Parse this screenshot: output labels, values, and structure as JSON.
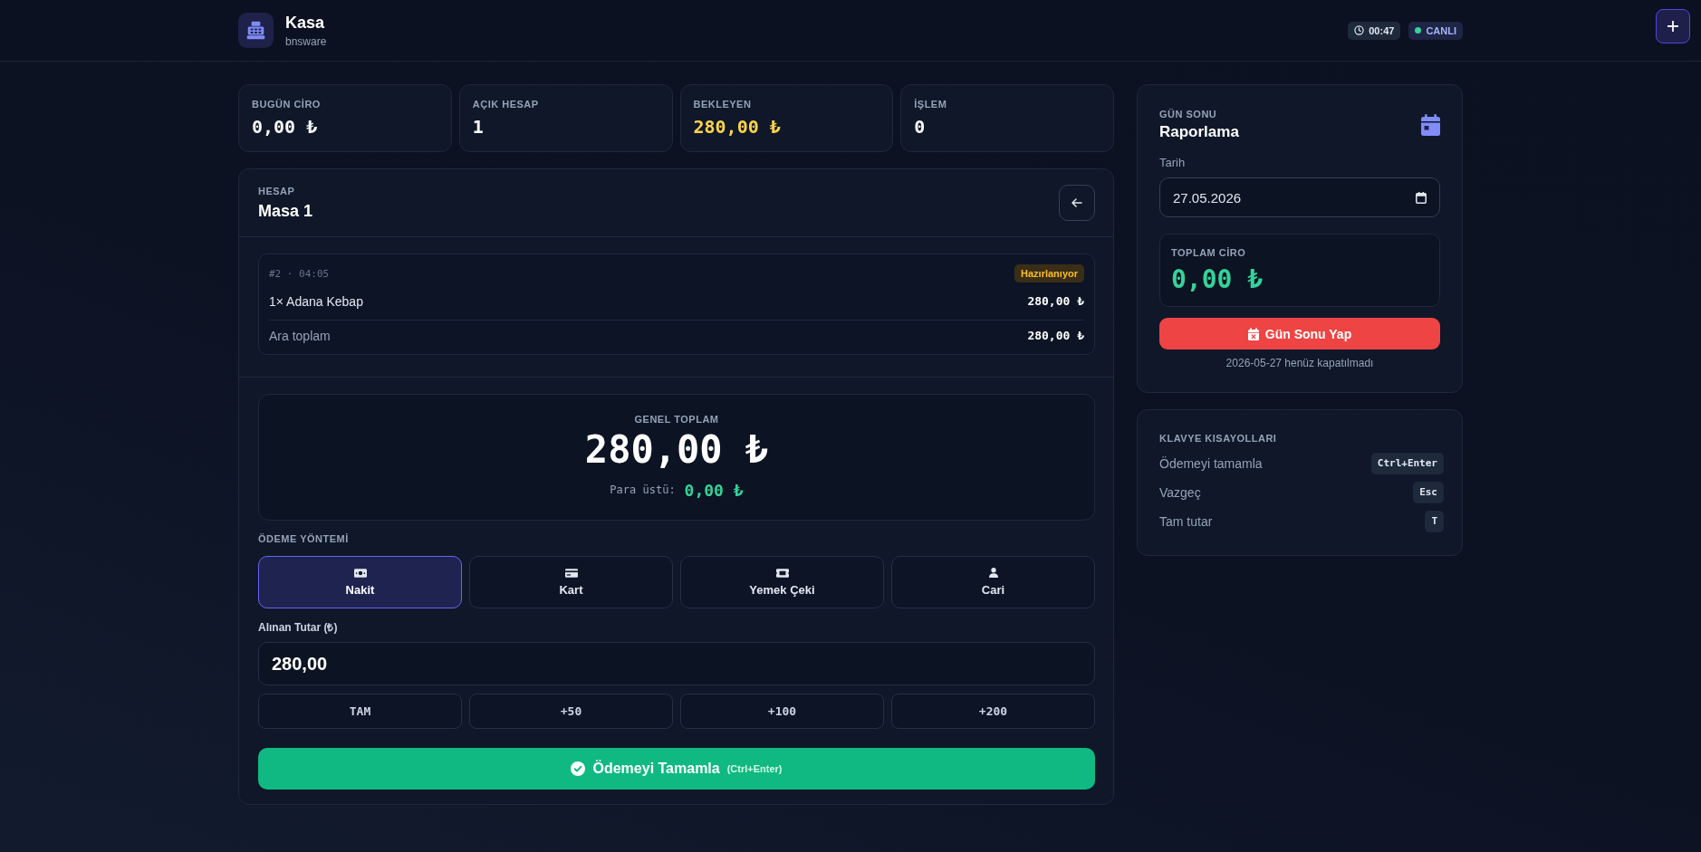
{
  "header": {
    "title": "Kasa",
    "subtitle": "bnsware",
    "timer": "00:47",
    "status": "CANLI"
  },
  "stats": [
    {
      "label": "BUGÜN CİRO",
      "value": "0,00 ₺",
      "color": "#f8fafc"
    },
    {
      "label": "AÇIK HESAP",
      "value": "1",
      "color": "#f8fafc"
    },
    {
      "label": "BEKLEYEN",
      "value": "280,00 ₺",
      "color": "#fcd34d"
    },
    {
      "label": "İŞLEM",
      "value": "0",
      "color": "#f8fafc"
    }
  ],
  "account": {
    "label": "HESAP",
    "title": "Masa 1",
    "order": {
      "meta": "#2 · 04:05",
      "status": "Hazırlanıyor",
      "items": [
        {
          "name": "1× Adana Kebap",
          "price": "280,00 ₺"
        }
      ],
      "subtotal_label": "Ara toplam",
      "subtotal": "280,00 ₺"
    },
    "total": {
      "label": "GENEL TOPLAM",
      "value": "280,00 ₺",
      "change_label": "Para üstü:",
      "change": "0,00 ₺"
    },
    "payment": {
      "label": "ÖDEME YÖNTEMİ",
      "methods": [
        {
          "label": "Nakit",
          "kind": "cash",
          "selected": true
        },
        {
          "label": "Kart",
          "kind": "card",
          "selected": false
        },
        {
          "label": "Yemek Çeki",
          "kind": "voucher",
          "selected": false
        },
        {
          "label": "Cari",
          "kind": "person",
          "selected": false
        }
      ]
    },
    "amount": {
      "label": "Alınan Tutar (₺)",
      "value": "280,00"
    },
    "quick_amounts": [
      "TAM",
      "+50",
      "+100",
      "+200"
    ],
    "submit": {
      "label": "Ödemeyi Tamamla",
      "shortcut": "(Ctrl+Enter)"
    }
  },
  "day_end": {
    "eyebrow": "GÜN SONU",
    "title": "Raporlama",
    "date_label": "Tarih",
    "date": "27.05.2026",
    "total_label": "TOPLAM CİRO",
    "total": "0,00 ₺",
    "button": "Gün Sonu Yap",
    "note": "2026-05-27 henüz kapatılmadı"
  },
  "shortcuts": {
    "title": "KLAVYE KISAYOLLARI",
    "items": [
      {
        "action": "Ödemeyi tamamla",
        "keys": "Ctrl+Enter"
      },
      {
        "action": "Vazgeç",
        "keys": "Esc"
      },
      {
        "action": "Tam tutar",
        "keys": "T"
      }
    ]
  }
}
